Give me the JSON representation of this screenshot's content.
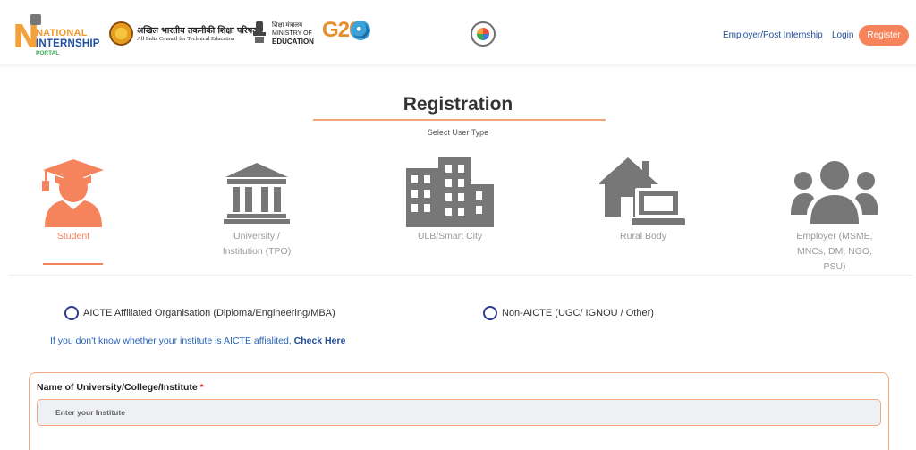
{
  "header": {
    "logo_national": "NATIONAL",
    "logo_internship": "INTERNSHIP",
    "logo_portal": "PORTAL",
    "aicte_hindi": "अखिल भारतीय तकनीकी शिक्षा परिषद्",
    "aicte_english": "All India Council for Technical Education",
    "moe_hindi": "शिक्षा मंत्रालय",
    "moe_line1": "MINISTRY OF",
    "moe_line2": "EDUCATION",
    "g20": "G20",
    "nav_employer": "Employer/Post Internship",
    "nav_login": "Login",
    "nav_register": "Register"
  },
  "registration": {
    "title": "Registration",
    "subtitle": "Select User Type"
  },
  "user_types": [
    {
      "label": "Student",
      "icon": "student-graduate-icon",
      "active": true
    },
    {
      "label": "University / Institution (TPO)",
      "icon": "university-building-icon",
      "active": false
    },
    {
      "label": "ULB/Smart City",
      "icon": "city-buildings-icon",
      "active": false
    },
    {
      "label": "Rural Body",
      "icon": "rural-house-laptop-icon",
      "active": false
    },
    {
      "label": "Employer (MSME, MNCs, DM, NGO, PSU)",
      "icon": "employer-group-icon",
      "active": false
    }
  ],
  "affiliation": {
    "option_aicte": "AICTE Affiliated Organisation (Diploma/Engineering/MBA)",
    "option_non_aicte": "Non-AICTE (UGC/ IGNOU / Other)",
    "hint_text": "If you don't know whether your institute is AICTE affialited, ",
    "hint_link": "Check Here"
  },
  "form": {
    "institute_label": "Name of University/College/Institute",
    "required_mark": "*",
    "institute_placeholder": "Enter your Institute"
  },
  "colors": {
    "accent": "#f5845c",
    "active_icon": "#f5845c",
    "inactive_icon": "#777777",
    "link": "#1f4c96"
  }
}
